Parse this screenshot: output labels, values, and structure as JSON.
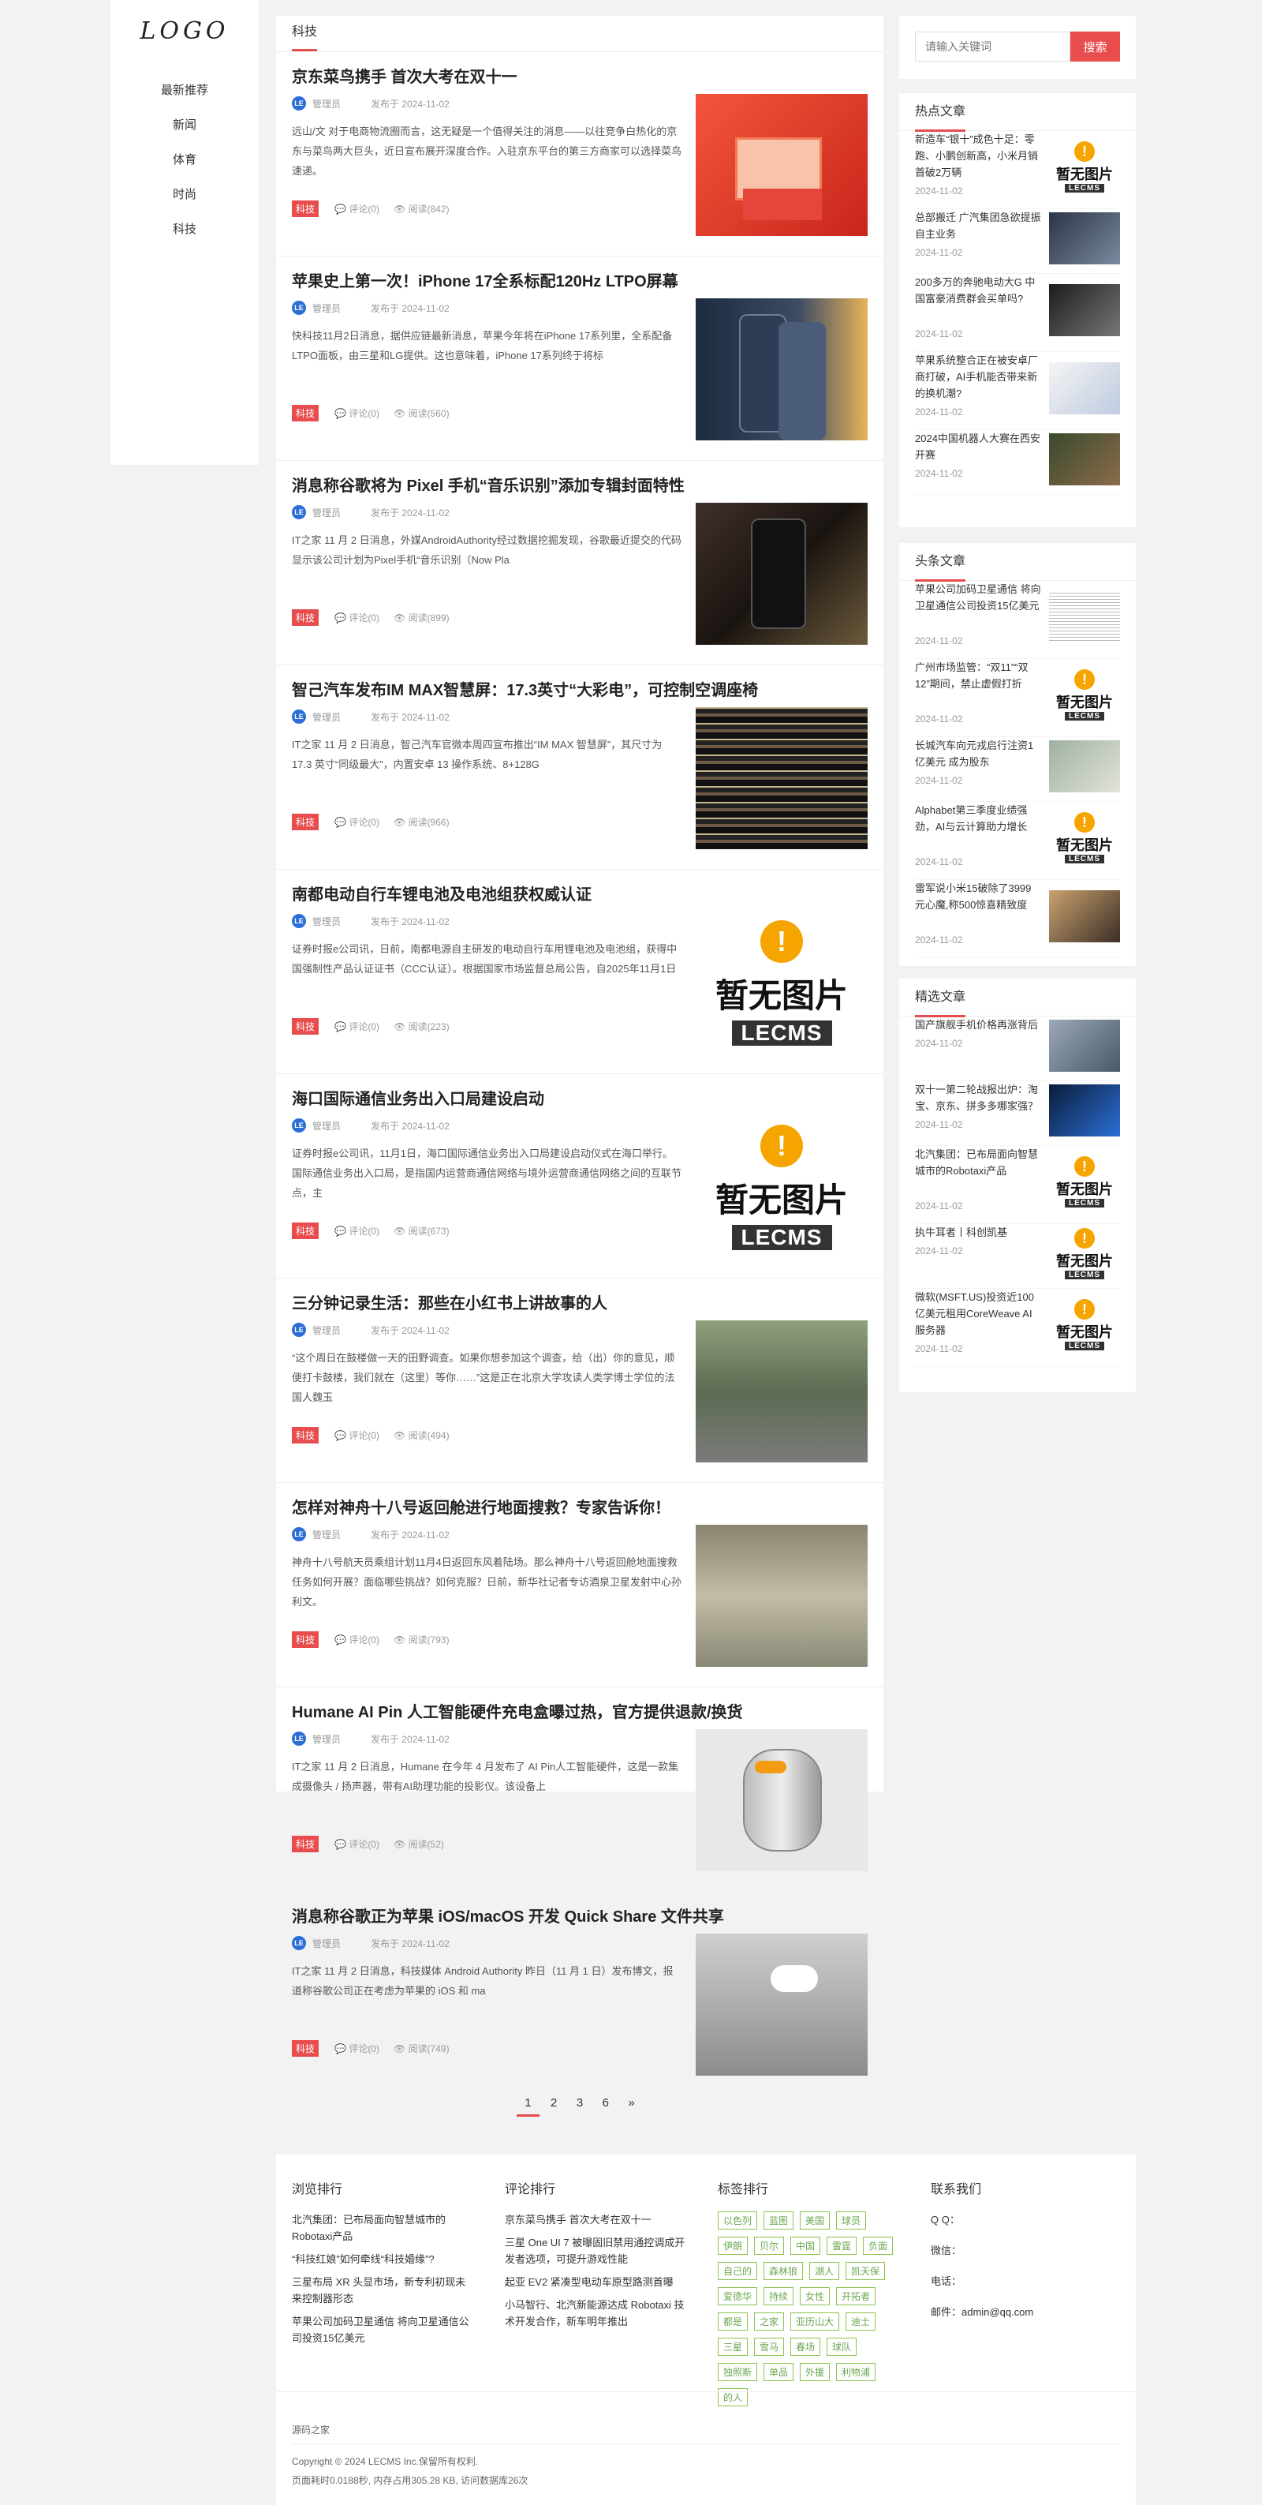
{
  "nav": {
    "logo": "LOGO",
    "items": [
      "最新推荐",
      "新闻",
      "体育",
      "时尚",
      "科技"
    ]
  },
  "category": "科技",
  "placeholder_image": {
    "badge": "!",
    "text": "暂无图片",
    "brand": "LECMS"
  },
  "articles": [
    {
      "title": "京东菜鸟携手 首次大考在双十一",
      "author": "管理员",
      "date": "发布于 2024-11-02",
      "desc": "远山/文 对于电商物流圈而言，这无疑是一个值得关注的消息——以往竞争白热化的京东与菜鸟两大巨头，近日宣布展开深度合作。入驻京东平台的第三方商家可以选择菜鸟速递。",
      "tag": "科技",
      "comments": "评论(0)",
      "views": "阅读(842)"
    },
    {
      "title": "苹果史上第一次！iPhone 17全系标配120Hz LTPO屏幕",
      "author": "管理员",
      "date": "发布于 2024-11-02",
      "desc": "快科技11月2日消息，据供应链最新消息，苹果今年将在iPhone 17系列里，全系配备LTPO面板，由三星和LG提供。这也意味着，iPhone 17系列终于将标",
      "tag": "科技",
      "comments": "评论(0)",
      "views": "阅读(560)"
    },
    {
      "title": "消息称谷歌将为 Pixel 手机“音乐识别”添加专辑封面特性",
      "author": "管理员",
      "date": "发布于 2024-11-02",
      "desc": "IT之家 11 月 2 日消息，外媒AndroidAuthority经过数据挖掘发现，谷歌最近提交的代码显示该公司计划为Pixel手机“音乐识别（Now Pla",
      "tag": "科技",
      "comments": "评论(0)",
      "views": "阅读(899)"
    },
    {
      "title": "智己汽车发布IM MAX智慧屏：17.3英寸“大彩电”，可控制空调座椅",
      "author": "管理员",
      "date": "发布于 2024-11-02",
      "desc": "IT之家 11 月 2 日消息，智己汽车官微本周四宣布推出“IM MAX 智慧屏”，其尺寸为 17.3 英寸“同级最大”，内置安卓 13 操作系统、8+128G",
      "tag": "科技",
      "comments": "评论(0)",
      "views": "阅读(966)"
    },
    {
      "title": "南都电动自行车锂电池及电池组获权威认证",
      "author": "管理员",
      "date": "发布于 2024-11-02",
      "desc": "证券时报e公司讯，日前，南都电源自主研发的电动自行车用锂电池及电池组，获得中国强制性产品认证证书（CCC认证）。根据国家市场监督总局公告，自2025年11月1日",
      "tag": "科技",
      "comments": "评论(0)",
      "views": "阅读(223)"
    },
    {
      "title": "海口国际通信业务出入口局建设启动",
      "author": "管理员",
      "date": "发布于 2024-11-02",
      "desc": "证券时报e公司讯，11月1日，海口国际通信业务出入口局建设启动仪式在海口举行。国际通信业务出入口局，是指国内运营商通信网络与境外运营商通信网络之间的互联节点，主",
      "tag": "科技",
      "comments": "评论(0)",
      "views": "阅读(673)"
    },
    {
      "title": "三分钟记录生活：那些在小红书上讲故事的人",
      "author": "管理员",
      "date": "发布于 2024-11-02",
      "desc": "“这个周日在鼓楼做一天的田野调查。如果你想参加这个调查，给（出）你的意见，顺便打卡鼓楼，我们就在（这里）等你……”这是正在北京大学攻读人类学博士学位的法国人魏玉",
      "tag": "科技",
      "comments": "评论(0)",
      "views": "阅读(494)"
    },
    {
      "title": "怎样对神舟十八号返回舱进行地面搜救？专家告诉你！",
      "author": "管理员",
      "date": "发布于 2024-11-02",
      "desc": "神舟十八号航天员乘组计划11月4日返回东风着陆场。那么神舟十八号返回舱地面搜救任务如何开展？面临哪些挑战？如何克服？日前，新华社记者专访酒泉卫星发射中心孙利文。",
      "tag": "科技",
      "comments": "评论(0)",
      "views": "阅读(793)"
    },
    {
      "title": "Humane AI Pin 人工智能硬件充电盒曝过热，官方提供退款/换货",
      "author": "管理员",
      "date": "发布于 2024-11-02",
      "desc": "IT之家 11 月 2 日消息，Humane 在今年 4 月发布了 AI Pin人工智能硬件，这是一款集成摄像头 / 扬声器，带有AI助理功能的投影仪。该设备上",
      "tag": "科技",
      "comments": "评论(0)",
      "views": "阅读(52)"
    },
    {
      "title": "消息称谷歌正为苹果 iOS/macOS 开发 Quick Share 文件共享",
      "author": "管理员",
      "date": "发布于 2024-11-02",
      "desc": "IT之家 11 月 2 日消息，科技媒体 Android Authority 昨日（11 月 1 日）发布博文，报道称谷歌公司正在考虑为苹果的 iOS 和 ma",
      "tag": "科技",
      "comments": "评论(0)",
      "views": "阅读(749)"
    }
  ],
  "pagination": {
    "current": "1",
    "pages": [
      "2",
      "3",
      "6"
    ],
    "next": "»"
  },
  "search": {
    "placeholder": "请输入关键词",
    "button": "搜索"
  },
  "hot": {
    "title": "热点文章",
    "items": [
      {
        "title": "新造车“银十”成色十足：零跑、小鹏创新高，小米月销首破2万辆",
        "date": "2024-11-02"
      },
      {
        "title": "总部搬迁 广汽集团急欲提振自主业务",
        "date": "2024-11-02"
      },
      {
        "title": "200多万的奔驰电动大G 中国富豪消费群会买单吗?",
        "date": "2024-11-02"
      },
      {
        "title": "苹果系统整合正在被安卓厂商打破，AI手机能否带来新的换机潮?",
        "date": "2024-11-02"
      },
      {
        "title": "2024中国机器人大赛在西安开赛",
        "date": "2024-11-02"
      }
    ]
  },
  "headline": {
    "title": "头条文章",
    "items": [
      {
        "title": "苹果公司加码卫星通信 将向卫星通信公司投资15亿美元",
        "date": "2024-11-02"
      },
      {
        "title": "广州市场监管：“双11”“双12”期间，禁止虚假打折",
        "date": "2024-11-02"
      },
      {
        "title": "长城汽车向元戎启行注资1亿美元 成为股东",
        "date": "2024-11-02"
      },
      {
        "title": "Alphabet第三季度业绩强劲，AI与云计算助力增长",
        "date": "2024-11-02"
      },
      {
        "title": "雷军说小米15破除了3999元心魔,称500惊喜精致度",
        "date": "2024-11-02"
      }
    ]
  },
  "picks": {
    "title": "精选文章",
    "items": [
      {
        "title": "国产旗舰手机价格再涨背后",
        "date": "2024-11-02"
      },
      {
        "title": "双十一第二轮战报出炉：淘宝、京东、拼多多哪家强？",
        "date": "2024-11-02"
      },
      {
        "title": "北汽集团：已布局面向智慧城市的Robotaxi产品",
        "date": "2024-11-02"
      },
      {
        "title": "执牛耳者丨科创凯基",
        "date": "2024-11-02"
      },
      {
        "title": "微软(MSFT.US)投资近100亿美元租用CoreWeave AI服务器",
        "date": "2024-11-02"
      }
    ]
  },
  "footer": {
    "browse": {
      "title": "浏览排行",
      "items": [
        "北汽集团：已布局面向智慧城市的Robotaxi产品",
        "“科技红娘”如何牵线“科技婚缘”?",
        "三星布局 XR 头显市场，新专利初现未来控制器形态",
        "苹果公司加码卫星通信 将向卫星通信公司投资15亿美元"
      ]
    },
    "comment": {
      "title": "评论排行",
      "items": [
        "京东菜鸟携手 首次大考在双十一",
        "三星 One UI 7 被曝固旧禁用通控调成开发者选项，可提升游戏性能",
        "起亚 EV2 紧凑型电动车原型路测首曝",
        "小马智行、北汽新能源达成 Robotaxi 技术开发合作，新车明年推出"
      ]
    },
    "tags": {
      "title": "标签排行",
      "items": [
        "以色列",
        "蓝图",
        "美国",
        "球员",
        "伊朗",
        "贝尔",
        "中国",
        "雷霆",
        "负面",
        "自己的",
        "森林狼",
        "湖人",
        "凯天保",
        "爱德华",
        "持续",
        "女性",
        "开拓者",
        "都是",
        "之家",
        "亚历山大",
        "迪士",
        "三星",
        "雪马",
        "春场",
        "球队",
        "独照斯",
        "单品",
        "外援",
        "利物浦",
        "的人"
      ]
    },
    "contact": {
      "title": "联系我们",
      "qq": "Q Q：",
      "wechat": "微信：",
      "phone": "电话：",
      "email": "邮件：admin@qq.com"
    },
    "site": "源码之家",
    "copyright": "Copyright © 2024 LECMS Inc.保留所有权利.",
    "stats": "页面耗时0.0188秒, 内存占用305.28 KB, 访问数据库26次"
  },
  "colors": {
    "accent": "#e84c4c",
    "tag_green": "#8bc34a",
    "avatar_blue": "#2b6fd6"
  }
}
